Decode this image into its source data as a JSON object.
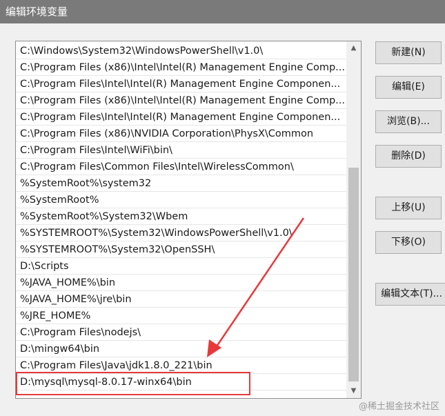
{
  "window": {
    "title": "编辑环境变量"
  },
  "path_list": {
    "items": [
      "C:\\Windows\\System32\\WindowsPowerShell\\v1.0\\",
      "C:\\Program Files (x86)\\Intel\\Intel(R) Management Engine Comp...",
      "C:\\Program Files\\Intel\\Intel(R) Management Engine Componen...",
      "C:\\Program Files (x86)\\Intel\\Intel(R) Management Engine Comp...",
      "C:\\Program Files\\Intel\\Intel(R) Management Engine Componen...",
      "C:\\Program Files (x86)\\NVIDIA Corporation\\PhysX\\Common",
      "C:\\Program Files\\Intel\\WiFi\\bin\\",
      "C:\\Program Files\\Common Files\\Intel\\WirelessCommon\\",
      "%SystemRoot%\\system32",
      "%SystemRoot%",
      "%SystemRoot%\\System32\\Wbem",
      "%SYSTEMROOT%\\System32\\WindowsPowerShell\\v1.0\\",
      "%SYSTEMROOT%\\System32\\OpenSSH\\",
      "D:\\Scripts",
      "%JAVA_HOME%\\bin",
      "%JAVA_HOME%\\jre\\bin",
      "%JRE_HOME%",
      "C:\\Program Files\\nodejs\\",
      "D:\\mingw64\\bin",
      "C:\\Program Files\\Java\\jdk1.8.0_221\\bin",
      "D:\\mysql\\mysql-8.0.17-winx64\\bin"
    ],
    "highlighted_index": 20
  },
  "buttons": {
    "new": "新建(N)",
    "edit": "编辑(E)",
    "browse": "浏览(B)...",
    "delete": "删除(D)",
    "move_up": "上移(U)",
    "move_down": "下移(O)",
    "edit_text": "编辑文本(T)..."
  },
  "watermark": "@稀土掘金技术社区",
  "colors": {
    "annotation": "#e8383b",
    "titlebar": "#7a7a7a"
  }
}
